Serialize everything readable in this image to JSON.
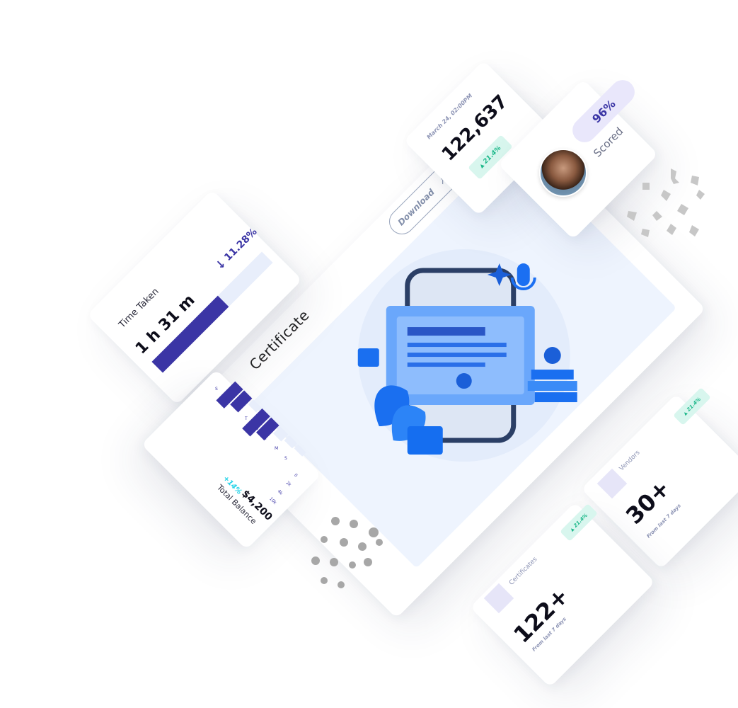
{
  "certificate": {
    "title": "Certificate",
    "download_label": "Download",
    "download_icon": "arrow-up-right-icon"
  },
  "views_card": {
    "date": "March 24, 02:00PM",
    "value": "122,637",
    "badge": "21.4%"
  },
  "score_card": {
    "percent": "96%",
    "label": "Scored"
  },
  "time_card": {
    "label": "Time Taken",
    "value": "1 h 31 m",
    "change": "11.28%",
    "change_icon": "arrow-down-icon",
    "progress": 0.6
  },
  "balance_card": {
    "label": "Total Balance",
    "value": "$4,200",
    "change": "+14%",
    "y_ticks": [
      "10k",
      "4k",
      "2k",
      "0"
    ],
    "days": [
      "S",
      "S",
      "F",
      "T",
      "W",
      "T",
      "M",
      "S"
    ]
  },
  "vendors_card": {
    "label": "Vendors",
    "value": "30+",
    "sub": "From last 7 days",
    "badge": "21.4%"
  },
  "certificates_card": {
    "label": "Certificates",
    "value": "122+",
    "sub": "From last 7 days",
    "badge": "21.4%"
  },
  "colors": {
    "accent": "#3b35a5",
    "blue": "#1479f3",
    "light_blue": "#eef3fd",
    "teal_badge": "#d8f6ee",
    "teal_text": "#1db88a",
    "cyan": "#27d3e8"
  }
}
